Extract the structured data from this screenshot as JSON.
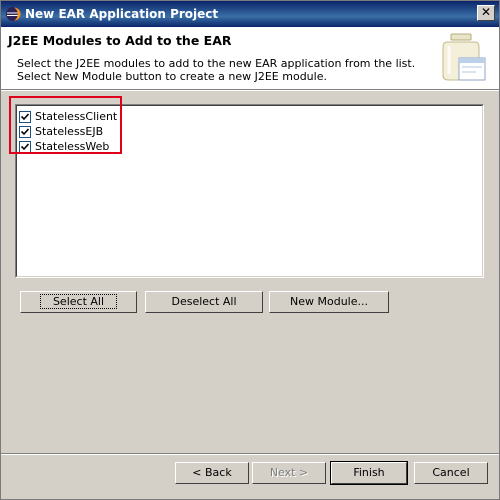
{
  "window": {
    "title": "New EAR Application Project"
  },
  "banner": {
    "heading": "J2EE Modules to Add to the EAR",
    "description_line1": "Select the J2EE modules to add to the new EAR application from the list.",
    "description_line2": "Select New Module button to create a new J2EE module.",
    "icon": "wizard-jar-icon"
  },
  "modules": [
    {
      "label": "StatelessClient",
      "checked": true
    },
    {
      "label": "StatelessEJB",
      "checked": true
    },
    {
      "label": "StatelessWeb",
      "checked": true
    }
  ],
  "list_buttons": {
    "select_all": "Select All",
    "deselect_all": "Deselect All",
    "new_module": "New Module..."
  },
  "footer_buttons": {
    "back": "< Back",
    "next": "Next >",
    "finish": "Finish",
    "cancel": "Cancel"
  },
  "colors": {
    "title_bar": "#0a246a",
    "highlight_box": "#e0001a",
    "dialog_bg": "#d4d0c8"
  }
}
